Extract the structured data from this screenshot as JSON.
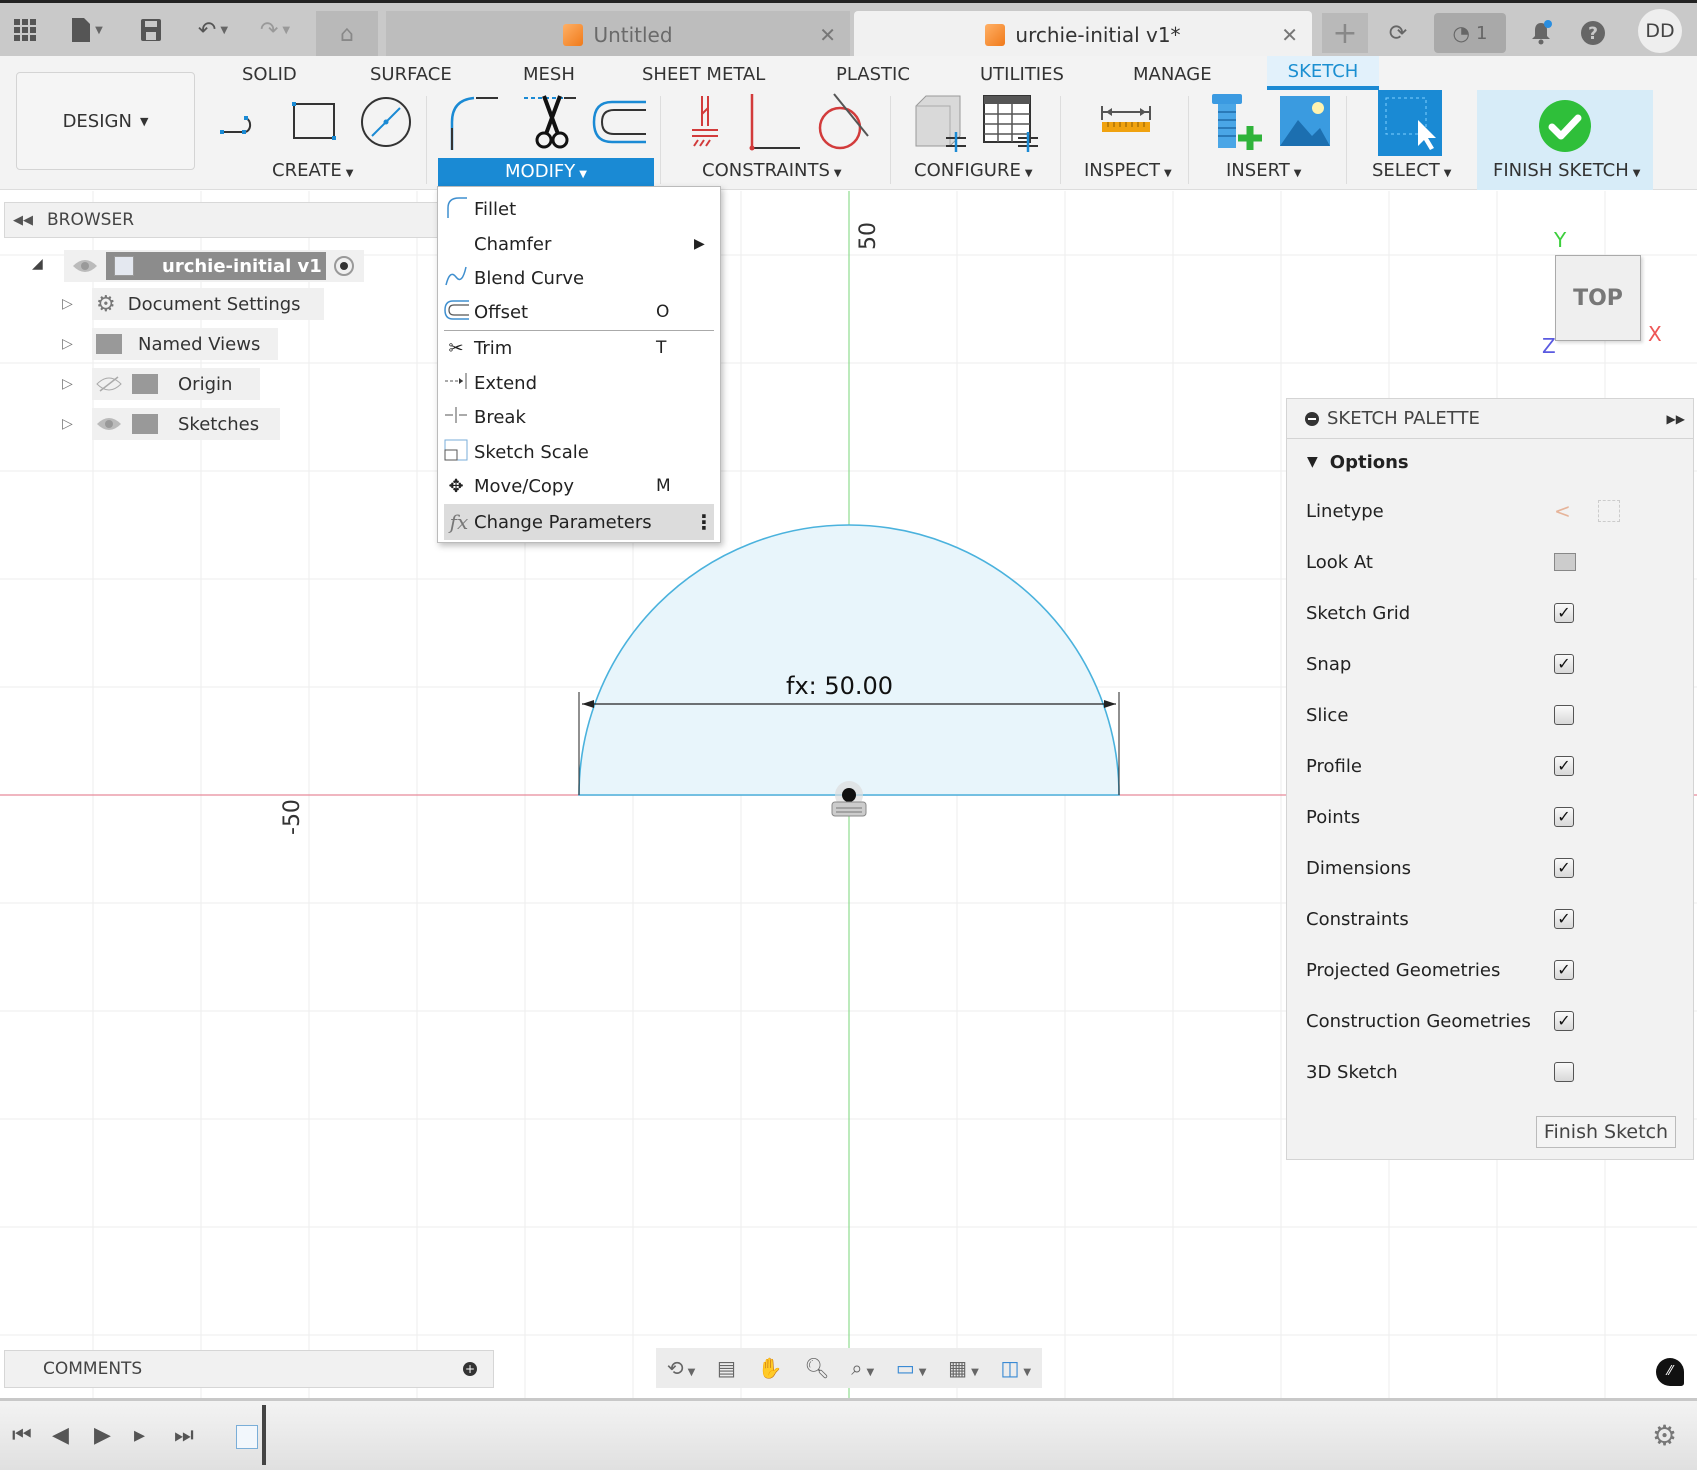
{
  "titlebar": {
    "tabs": [
      {
        "label": "Untitled",
        "active": false
      },
      {
        "label": "urchie-initial v1*",
        "active": true
      }
    ],
    "jobs_count": "1",
    "user_initials": "DD"
  },
  "ribbon": {
    "workspace": "DESIGN",
    "tabs": [
      "SOLID",
      "SURFACE",
      "MESH",
      "SHEET METAL",
      "PLASTIC",
      "UTILITIES",
      "MANAGE",
      "SKETCH"
    ],
    "active_tab": "SKETCH",
    "groups": [
      "CREATE",
      "MODIFY",
      "CONSTRAINTS",
      "CONFIGURE",
      "INSPECT",
      "INSERT",
      "SELECT",
      "FINISH SKETCH"
    ]
  },
  "browser": {
    "title": "BROWSER",
    "root": "urchie-initial v1",
    "items": [
      {
        "label": "Document Settings",
        "icon": "gear-icon"
      },
      {
        "label": "Named Views",
        "icon": "folder-icon"
      },
      {
        "label": "Origin",
        "icon": "folder-icon",
        "visibility": "hidden"
      },
      {
        "label": "Sketches",
        "icon": "folder-icon",
        "visibility": "visible"
      }
    ]
  },
  "modify_menu": {
    "items": [
      {
        "label": "Fillet",
        "shortcut": ""
      },
      {
        "label": "Chamfer",
        "shortcut": "",
        "submenu": true
      },
      {
        "label": "Blend Curve",
        "shortcut": ""
      },
      {
        "label": "Offset",
        "shortcut": "O"
      },
      {
        "label": "Trim",
        "shortcut": "T"
      },
      {
        "label": "Extend",
        "shortcut": ""
      },
      {
        "label": "Break",
        "shortcut": ""
      },
      {
        "label": "Sketch Scale",
        "shortcut": ""
      },
      {
        "label": "Move/Copy",
        "shortcut": "M"
      },
      {
        "label": "Change Parameters",
        "shortcut": "",
        "highlighted": true
      }
    ]
  },
  "canvas": {
    "axis_label_top": "50",
    "axis_label_left": "-50",
    "dimension": "fx: 50.00",
    "viewcube_face": "TOP",
    "axes": {
      "x": "X",
      "y": "Y",
      "z": "Z"
    }
  },
  "palette": {
    "title": "SKETCH PALETTE",
    "section": "Options",
    "rows": [
      {
        "label": "Linetype",
        "type": "icons"
      },
      {
        "label": "Look At",
        "type": "icon"
      },
      {
        "label": "Sketch Grid",
        "checked": true
      },
      {
        "label": "Snap",
        "checked": true
      },
      {
        "label": "Slice",
        "checked": false
      },
      {
        "label": "Profile",
        "checked": true
      },
      {
        "label": "Points",
        "checked": true
      },
      {
        "label": "Dimensions",
        "checked": true
      },
      {
        "label": "Constraints",
        "checked": true
      },
      {
        "label": "Projected Geometries",
        "checked": true
      },
      {
        "label": "Construction Geometries",
        "checked": true
      },
      {
        "label": "3D Sketch",
        "checked": false
      }
    ],
    "finish_label": "Finish Sketch"
  },
  "comments": {
    "label": "COMMENTS"
  },
  "colors": {
    "accent": "#1a8ad4",
    "sketch_fill": "#e8f5fb",
    "sketch_line": "#4ab2dd",
    "x_axis": "#e88a9a",
    "y_axis": "#8fdb8f",
    "finish_green": "#2fbf3a"
  }
}
